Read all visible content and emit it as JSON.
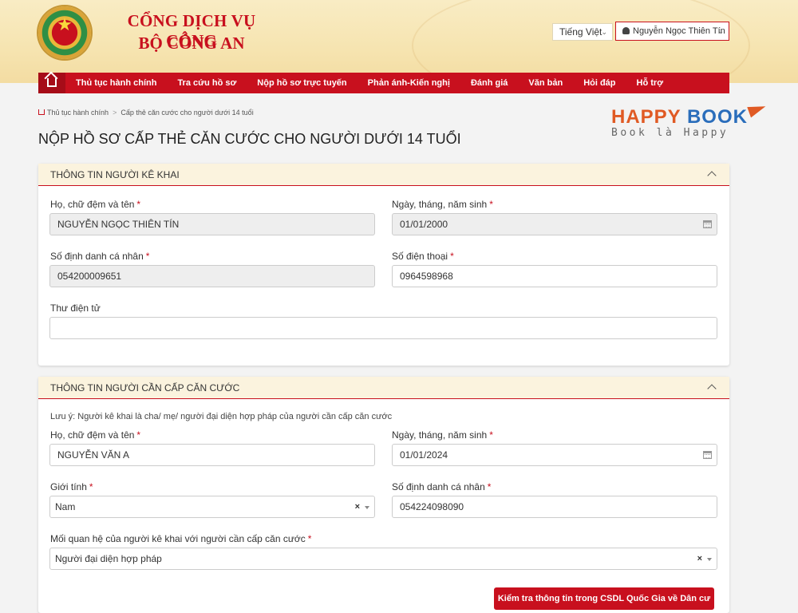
{
  "header": {
    "brand_line1": "CỔNG DỊCH VỤ CÔNG",
    "brand_line2": "BỘ CÔNG AN",
    "language": "Tiếng Việt",
    "user_name": "Nguyễn Ngọc Thiên Tín",
    "emblem_icon": "police-emblem-icon"
  },
  "nav": {
    "home_icon": "home-icon",
    "items": [
      "Thủ tục hành chính",
      "Tra cứu hồ sơ",
      "Nộp hồ sơ trực tuyến",
      "Phản ánh-Kiến nghị",
      "Đánh giá",
      "Văn bản",
      "Hỏi đáp",
      "Hỗ trợ"
    ]
  },
  "breadcrumb": {
    "items": [
      "Thủ tục hành chính",
      "Cấp thẻ căn cước cho người dưới 14 tuổi"
    ]
  },
  "page_title": "NỘP HỒ SƠ CẤP THẺ CĂN CƯỚC CHO NGƯỜI DƯỚI 14 TUỔI",
  "watermark_logo": {
    "happy": "HAPPY",
    "book": "BOOK",
    "tagline": "Book là Happy"
  },
  "declarant": {
    "title": "THÔNG TIN NGƯỜI KÊ KHAI",
    "full_name_label": "Họ, chữ đệm và tên",
    "full_name_value": "NGUYỄN NGỌC THIÊN TÍN",
    "dob_label": "Ngày, tháng, năm sinh",
    "dob_value": "01/01/2000",
    "id_label": "Số định danh cá nhân",
    "id_value": "054200009651",
    "phone_label": "Số điện thoại",
    "phone_value": "0964598968",
    "email_label": "Thư điện tử",
    "email_value": ""
  },
  "applicant": {
    "title": "THÔNG TIN NGƯỜI CẦN CẤP CĂN CƯỚC",
    "note": "Lưu ý: Người kê khai là cha/ mẹ/ người đại diện hợp pháp của người cần cấp căn cước",
    "full_name_label": "Họ, chữ đệm và tên",
    "full_name_value": "NGUYỄN VĂN A",
    "dob_label": "Ngày, tháng, năm sinh",
    "dob_value": "01/01/2024",
    "gender_label": "Giới tính",
    "gender_value": "Nam",
    "id_label": "Số định danh cá nhân",
    "id_value": "054224098090",
    "relation_label": "Mối quan hệ của người kê khai với người cần cấp căn cước",
    "relation_value": "Người đại diện hợp pháp",
    "check_button": "Kiểm tra thông tin trong CSDL Quốc Gia về Dân cư"
  },
  "colors": {
    "primary": "#c8101e",
    "header_bg": "#f6e4b0",
    "section_bg": "#fbf3de"
  }
}
